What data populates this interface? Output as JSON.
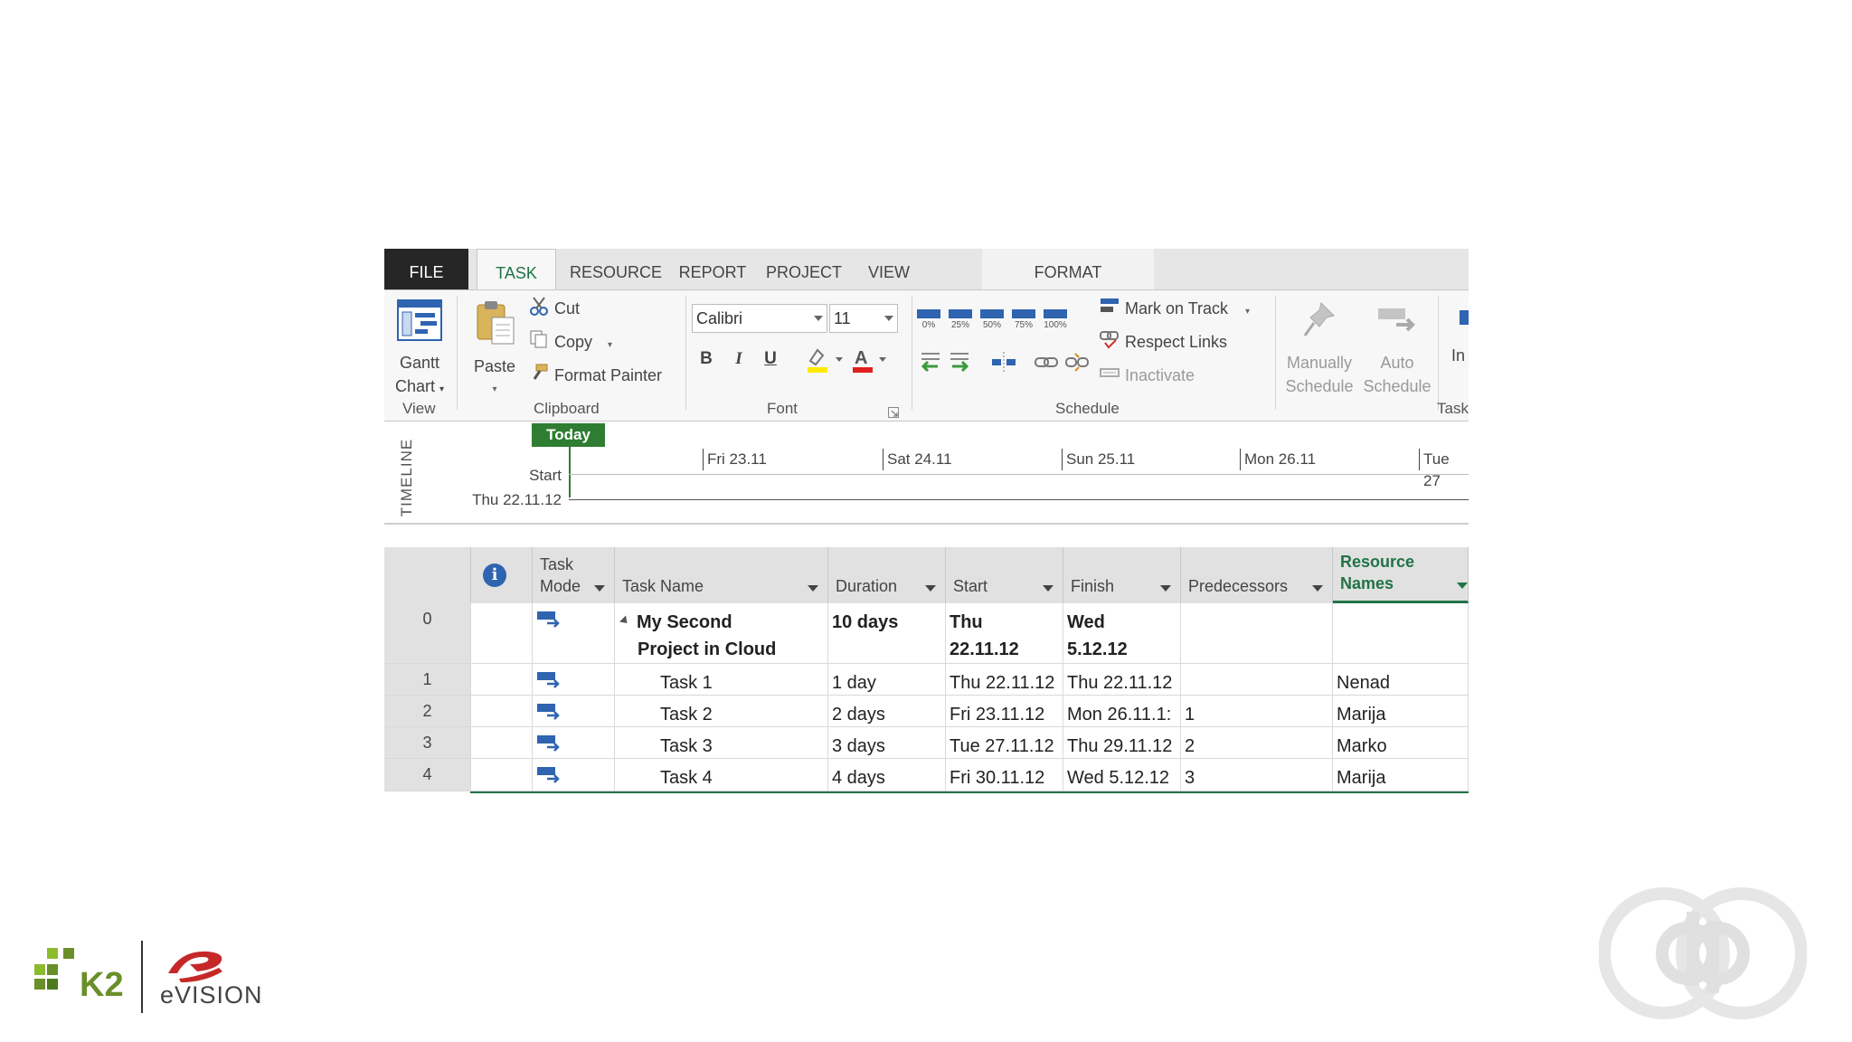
{
  "tabs": {
    "file": "FILE",
    "task": "TASK",
    "resource": "RESOURCE",
    "report": "REPORT",
    "project": "PROJECT",
    "view": "VIEW",
    "format": "FORMAT"
  },
  "ribbon": {
    "view_group": {
      "label": "View",
      "gantt_line1": "Gantt",
      "gantt_line2": "Chart"
    },
    "clipboard_group": {
      "label": "Clipboard",
      "paste": "Paste",
      "cut": "Cut",
      "copy": "Copy",
      "format_painter": "Format Painter"
    },
    "font_group": {
      "label": "Font",
      "font_name": "Calibri",
      "font_size": "11",
      "bold": "B",
      "italic": "I",
      "underline": "U"
    },
    "schedule_group": {
      "label": "Schedule",
      "percents": [
        "0%",
        "25%",
        "50%",
        "75%",
        "100%"
      ],
      "mark_on_track": "Mark on Track",
      "respect_links": "Respect Links",
      "inactivate": "Inactivate"
    },
    "tasks_group": {
      "label": "Task",
      "manually_line1": "Manually",
      "manually_line2": "Schedule",
      "auto_line1": "Auto",
      "auto_line2": "Schedule",
      "insert_partial": "In"
    }
  },
  "timeline": {
    "label": "TIMELINE",
    "today": "Today",
    "start_label": "Start",
    "start_date": "Thu 22.11.12",
    "dates": [
      "Fri 23.11",
      "Sat 24.11",
      "Sun 25.11",
      "Mon 26.11",
      "Tue 27"
    ]
  },
  "grid": {
    "headers": {
      "task_mode_1": "Task",
      "task_mode_2": "Mode",
      "task_name": "Task Name",
      "duration": "Duration",
      "start": "Start",
      "finish": "Finish",
      "predecessors": "Predecessors",
      "resource_1": "Resource",
      "resource_2": "Names"
    },
    "rows": [
      {
        "id": "0",
        "name_line1": "My Second",
        "name_line2": "Project in Cloud",
        "duration": "10 days",
        "start_line1": "Thu",
        "start_line2": "22.11.12",
        "finish_line1": "Wed",
        "finish_line2": "5.12.12",
        "predecessors": "",
        "resources": ""
      },
      {
        "id": "1",
        "name": "Task 1",
        "duration": "1 day",
        "start": "Thu 22.11.12",
        "finish": "Thu 22.11.12",
        "predecessors": "",
        "resources": "Nenad"
      },
      {
        "id": "2",
        "name": "Task 2",
        "duration": "2 days",
        "start": "Fri 23.11.12",
        "finish": "Mon 26.11.1:",
        "predecessors": "1",
        "resources": "Marija"
      },
      {
        "id": "3",
        "name": "Task 3",
        "duration": "3 days",
        "start": "Tue 27.11.12",
        "finish": "Thu 29.11.12",
        "predecessors": "2",
        "resources": "Marko"
      },
      {
        "id": "4",
        "name": "Task 4",
        "duration": "4 days",
        "start": "Fri 30.11.12",
        "finish": "Wed 5.12.12",
        "predecessors": "3",
        "resources": "Marija"
      }
    ]
  },
  "logos": {
    "k2": "K2",
    "evision": "eVISION"
  },
  "colors": {
    "accent_green": "#217346",
    "today_green": "#2e7d32",
    "file_tab": "#262626",
    "icon_blue": "#2e64b0"
  }
}
